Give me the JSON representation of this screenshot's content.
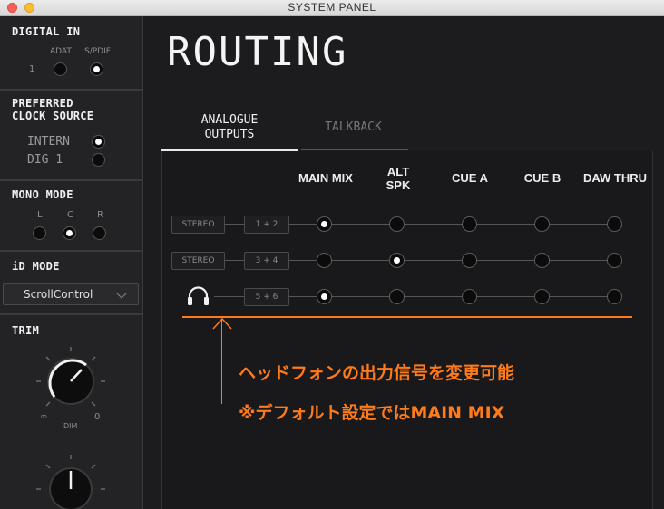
{
  "window": {
    "title": "SYSTEM PANEL"
  },
  "sidebar": {
    "digital_in": {
      "heading": "DIGITAL IN",
      "row_label": "1",
      "options": [
        "ADAT",
        "S/PDIF"
      ],
      "selected": "S/PDIF"
    },
    "clock": {
      "heading_line1": "PREFERRED",
      "heading_line2": "CLOCK SOURCE",
      "options": [
        "INTERN",
        "DIG 1"
      ],
      "selected": "INTERN"
    },
    "mono_mode": {
      "heading": "MONO MODE",
      "options": [
        "L",
        "C",
        "R"
      ],
      "selected": "C"
    },
    "id_mode": {
      "heading": "iD MODE",
      "value": "ScrollControl"
    },
    "trim": {
      "heading": "TRIM",
      "min_label": "∞",
      "max_label": "0",
      "dim_label": "DIM"
    }
  },
  "main": {
    "title": "ROUTING",
    "tabs": [
      {
        "label_line1": "ANALOGUE",
        "label_line2": "OUTPUTS",
        "active": true
      },
      {
        "label_line1": "TALKBACK",
        "label_line2": "",
        "active": false
      }
    ],
    "columns": [
      {
        "line1": "MAIN MIX",
        "line2": ""
      },
      {
        "line1": "ALT",
        "line2": "SPK"
      },
      {
        "line1": "CUE A",
        "line2": ""
      },
      {
        "line1": "CUE B",
        "line2": ""
      },
      {
        "line1": "DAW THRU",
        "line2": ""
      }
    ],
    "rows": [
      {
        "type": "STEREO",
        "channels": "1 + 2",
        "selected_column": "MAIN MIX"
      },
      {
        "type": "STEREO",
        "channels": "3 + 4",
        "selected_column": "ALT SPK"
      },
      {
        "type": "headphones-icon",
        "channels": "5 + 6",
        "selected_column": "MAIN MIX"
      }
    ]
  },
  "annotation": {
    "line1": "ヘッドフォンの出力信号を変更可能",
    "line2": "※デフォルト設定ではMAIN MIX",
    "color": "#ff7a1a"
  }
}
